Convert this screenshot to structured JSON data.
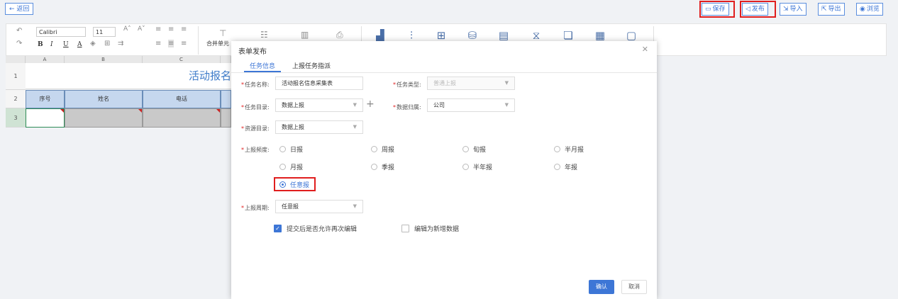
{
  "topbar": {
    "back_label": "← 返回",
    "save_label": "保存",
    "publish_label": "发布",
    "import_label": "导入",
    "export_label": "导出",
    "preview_label": "浏览"
  },
  "ribbon": {
    "font_name": "Calibri",
    "font_size": "11",
    "merge_label": "合并单元"
  },
  "sheet": {
    "columns": [
      "A",
      "B",
      "C"
    ],
    "rows": [
      "1",
      "2",
      "3"
    ],
    "title": "活动报名",
    "headers": [
      "序号",
      "姓名",
      "电话"
    ]
  },
  "dialog": {
    "title": "表单发布",
    "tabs": [
      "任务信息",
      "上报任务指派"
    ],
    "fields": {
      "task_name_label": "任务名称:",
      "task_name_value": "活动报名信息采集表",
      "task_type_label": "任务类型:",
      "task_type_value": "普通上报",
      "task_dir_label": "任务目录:",
      "task_dir_value": "数据上报",
      "data_owner_label": "数据归属:",
      "data_owner_value": "公司",
      "resource_dir_label": "资源目录:",
      "resource_dir_value": "数据上报",
      "freq_label": "上报频度:",
      "period_label": "上报周期:",
      "period_value": "任意报"
    },
    "frequencies": [
      "日报",
      "周报",
      "旬报",
      "半月报",
      "月报",
      "季报",
      "半年报",
      "年报",
      "任意报"
    ],
    "selected_frequency": "任意报",
    "check_allow_edit": "提交后是否允许再次编辑",
    "check_new_data": "编辑为新增数据",
    "ok_label": "确认",
    "cancel_label": "取消"
  }
}
